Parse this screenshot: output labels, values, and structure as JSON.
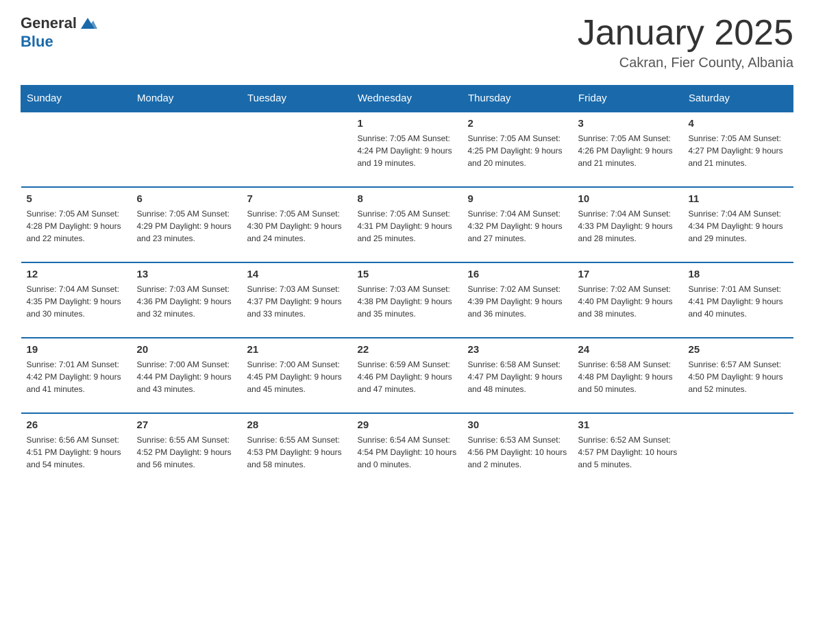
{
  "header": {
    "logo": {
      "general": "General",
      "blue": "Blue"
    },
    "title": "January 2025",
    "subtitle": "Cakran, Fier County, Albania"
  },
  "calendar": {
    "days": [
      "Sunday",
      "Monday",
      "Tuesday",
      "Wednesday",
      "Thursday",
      "Friday",
      "Saturday"
    ],
    "weeks": [
      [
        {
          "day": "",
          "info": ""
        },
        {
          "day": "",
          "info": ""
        },
        {
          "day": "",
          "info": ""
        },
        {
          "day": "1",
          "info": "Sunrise: 7:05 AM\nSunset: 4:24 PM\nDaylight: 9 hours\nand 19 minutes."
        },
        {
          "day": "2",
          "info": "Sunrise: 7:05 AM\nSunset: 4:25 PM\nDaylight: 9 hours\nand 20 minutes."
        },
        {
          "day": "3",
          "info": "Sunrise: 7:05 AM\nSunset: 4:26 PM\nDaylight: 9 hours\nand 21 minutes."
        },
        {
          "day": "4",
          "info": "Sunrise: 7:05 AM\nSunset: 4:27 PM\nDaylight: 9 hours\nand 21 minutes."
        }
      ],
      [
        {
          "day": "5",
          "info": "Sunrise: 7:05 AM\nSunset: 4:28 PM\nDaylight: 9 hours\nand 22 minutes."
        },
        {
          "day": "6",
          "info": "Sunrise: 7:05 AM\nSunset: 4:29 PM\nDaylight: 9 hours\nand 23 minutes."
        },
        {
          "day": "7",
          "info": "Sunrise: 7:05 AM\nSunset: 4:30 PM\nDaylight: 9 hours\nand 24 minutes."
        },
        {
          "day": "8",
          "info": "Sunrise: 7:05 AM\nSunset: 4:31 PM\nDaylight: 9 hours\nand 25 minutes."
        },
        {
          "day": "9",
          "info": "Sunrise: 7:04 AM\nSunset: 4:32 PM\nDaylight: 9 hours\nand 27 minutes."
        },
        {
          "day": "10",
          "info": "Sunrise: 7:04 AM\nSunset: 4:33 PM\nDaylight: 9 hours\nand 28 minutes."
        },
        {
          "day": "11",
          "info": "Sunrise: 7:04 AM\nSunset: 4:34 PM\nDaylight: 9 hours\nand 29 minutes."
        }
      ],
      [
        {
          "day": "12",
          "info": "Sunrise: 7:04 AM\nSunset: 4:35 PM\nDaylight: 9 hours\nand 30 minutes."
        },
        {
          "day": "13",
          "info": "Sunrise: 7:03 AM\nSunset: 4:36 PM\nDaylight: 9 hours\nand 32 minutes."
        },
        {
          "day": "14",
          "info": "Sunrise: 7:03 AM\nSunset: 4:37 PM\nDaylight: 9 hours\nand 33 minutes."
        },
        {
          "day": "15",
          "info": "Sunrise: 7:03 AM\nSunset: 4:38 PM\nDaylight: 9 hours\nand 35 minutes."
        },
        {
          "day": "16",
          "info": "Sunrise: 7:02 AM\nSunset: 4:39 PM\nDaylight: 9 hours\nand 36 minutes."
        },
        {
          "day": "17",
          "info": "Sunrise: 7:02 AM\nSunset: 4:40 PM\nDaylight: 9 hours\nand 38 minutes."
        },
        {
          "day": "18",
          "info": "Sunrise: 7:01 AM\nSunset: 4:41 PM\nDaylight: 9 hours\nand 40 minutes."
        }
      ],
      [
        {
          "day": "19",
          "info": "Sunrise: 7:01 AM\nSunset: 4:42 PM\nDaylight: 9 hours\nand 41 minutes."
        },
        {
          "day": "20",
          "info": "Sunrise: 7:00 AM\nSunset: 4:44 PM\nDaylight: 9 hours\nand 43 minutes."
        },
        {
          "day": "21",
          "info": "Sunrise: 7:00 AM\nSunset: 4:45 PM\nDaylight: 9 hours\nand 45 minutes."
        },
        {
          "day": "22",
          "info": "Sunrise: 6:59 AM\nSunset: 4:46 PM\nDaylight: 9 hours\nand 47 minutes."
        },
        {
          "day": "23",
          "info": "Sunrise: 6:58 AM\nSunset: 4:47 PM\nDaylight: 9 hours\nand 48 minutes."
        },
        {
          "day": "24",
          "info": "Sunrise: 6:58 AM\nSunset: 4:48 PM\nDaylight: 9 hours\nand 50 minutes."
        },
        {
          "day": "25",
          "info": "Sunrise: 6:57 AM\nSunset: 4:50 PM\nDaylight: 9 hours\nand 52 minutes."
        }
      ],
      [
        {
          "day": "26",
          "info": "Sunrise: 6:56 AM\nSunset: 4:51 PM\nDaylight: 9 hours\nand 54 minutes."
        },
        {
          "day": "27",
          "info": "Sunrise: 6:55 AM\nSunset: 4:52 PM\nDaylight: 9 hours\nand 56 minutes."
        },
        {
          "day": "28",
          "info": "Sunrise: 6:55 AM\nSunset: 4:53 PM\nDaylight: 9 hours\nand 58 minutes."
        },
        {
          "day": "29",
          "info": "Sunrise: 6:54 AM\nSunset: 4:54 PM\nDaylight: 10 hours\nand 0 minutes."
        },
        {
          "day": "30",
          "info": "Sunrise: 6:53 AM\nSunset: 4:56 PM\nDaylight: 10 hours\nand 2 minutes."
        },
        {
          "day": "31",
          "info": "Sunrise: 6:52 AM\nSunset: 4:57 PM\nDaylight: 10 hours\nand 5 minutes."
        },
        {
          "day": "",
          "info": ""
        }
      ]
    ]
  }
}
